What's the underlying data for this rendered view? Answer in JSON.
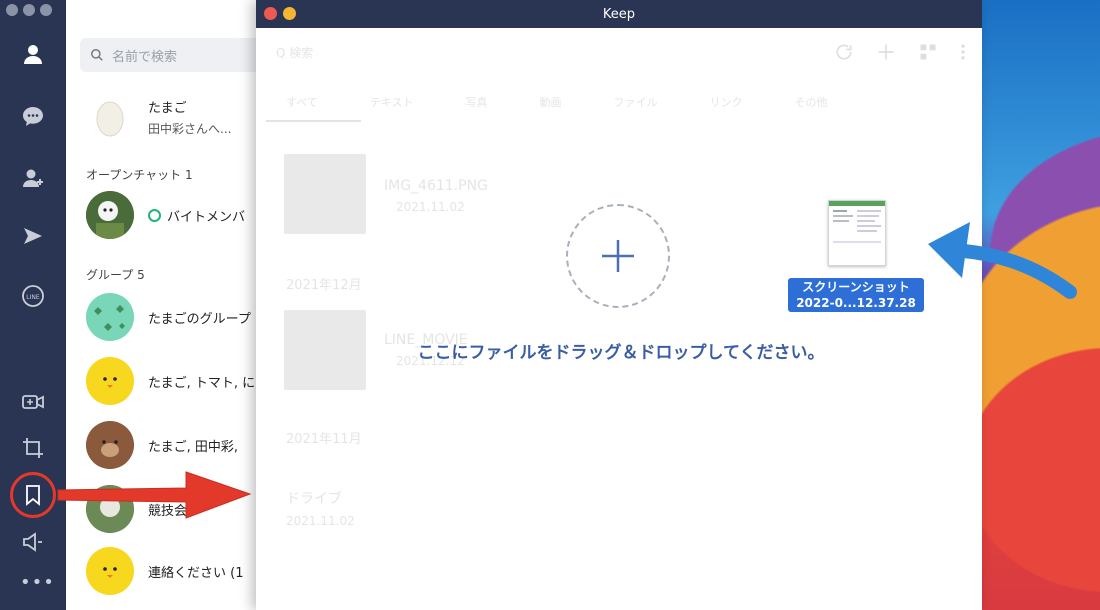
{
  "keep_window": {
    "title": "Keep",
    "drop_instruction": "ここにファイルをドラッグ＆ドロップしてください。",
    "toolbar_search": "Q 検索",
    "tabs": [
      "すべて",
      "テキスト",
      "写真",
      "動画",
      "ファイル",
      "リンク",
      "その他"
    ],
    "items": [
      {
        "name": "IMG_4611.PNG",
        "date": "2021.11.02"
      },
      {
        "section": "2021年12月"
      },
      {
        "name": "LINE_MOVIE",
        "date": "2021.12.12"
      },
      {
        "section": "2021年11月"
      },
      {
        "name": "ドライブ",
        "date": "2021.11.02"
      }
    ]
  },
  "dragged_file": {
    "line1": "スクリーンショット",
    "line2": "2022-0...12.37.28"
  },
  "sidebar": {
    "search_placeholder": "名前で検索",
    "top_chat": {
      "name": "たまご",
      "preview": "田中彩さんへ..."
    },
    "open_chat_section": "オープンチャット 1",
    "open_chat": {
      "name": "バイトメンバ"
    },
    "group_section": "グループ 5",
    "groups": [
      {
        "name": "たまごのグループ"
      },
      {
        "name": "たまご, トマト, に"
      },
      {
        "name": "たまご, 田中彩,"
      },
      {
        "name": "競技会"
      },
      {
        "name": "連絡ください (1"
      }
    ]
  },
  "colors": {
    "rail": "#2a3453",
    "accent_blue": "#3a5ea6",
    "highlight_red": "#e2392b",
    "arrow_blue": "#2f86d8"
  }
}
